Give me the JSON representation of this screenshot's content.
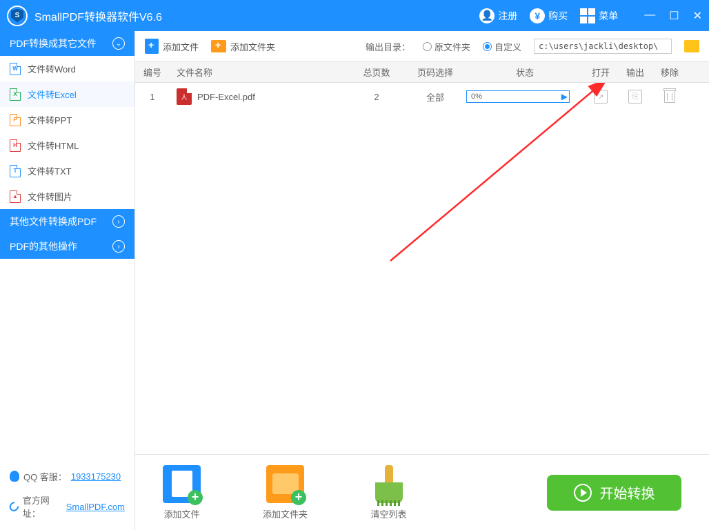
{
  "app": {
    "title": "SmallPDF转换器软件V6.6"
  },
  "titleActions": {
    "register": "注册",
    "buy": "购买",
    "menu": "菜单"
  },
  "sidebar": {
    "sections": [
      {
        "title": "PDF转换成其它文件"
      },
      {
        "title": "其他文件转换成PDF"
      },
      {
        "title": "PDF的其他操作"
      }
    ],
    "items": [
      {
        "label": "文件转Word",
        "icon": "W"
      },
      {
        "label": "文件转Excel",
        "icon": "X"
      },
      {
        "label": "文件转PPT",
        "icon": "P"
      },
      {
        "label": "文件转HTML",
        "icon": "H"
      },
      {
        "label": "文件转TXT",
        "icon": "T"
      },
      {
        "label": "文件转图片",
        "icon": "▲"
      }
    ],
    "footer": {
      "qqLabel": "QQ 客服：",
      "qq": "1933175230",
      "siteLabel": "官方网址：",
      "site": "SmallPDF.com"
    }
  },
  "toolbar": {
    "addFile": "添加文件",
    "addFolder": "添加文件夹",
    "outputLabel": "输出目录：",
    "origFolder": "原文件夹",
    "custom": "自定义",
    "path": "c:\\users\\jackli\\desktop\\"
  },
  "table": {
    "headers": {
      "num": "编号",
      "name": "文件名称",
      "pages": "总页数",
      "range": "页码选择",
      "status": "状态",
      "open": "打开",
      "out": "输出",
      "del": "移除"
    },
    "rows": [
      {
        "num": "1",
        "name": "PDF-Excel.pdf",
        "pages": "2",
        "range": "全部",
        "progress": "0%"
      }
    ]
  },
  "bottom": {
    "addFile": "添加文件",
    "addFolder": "添加文件夹",
    "clear": "清空列表",
    "convert": "开始转换"
  }
}
